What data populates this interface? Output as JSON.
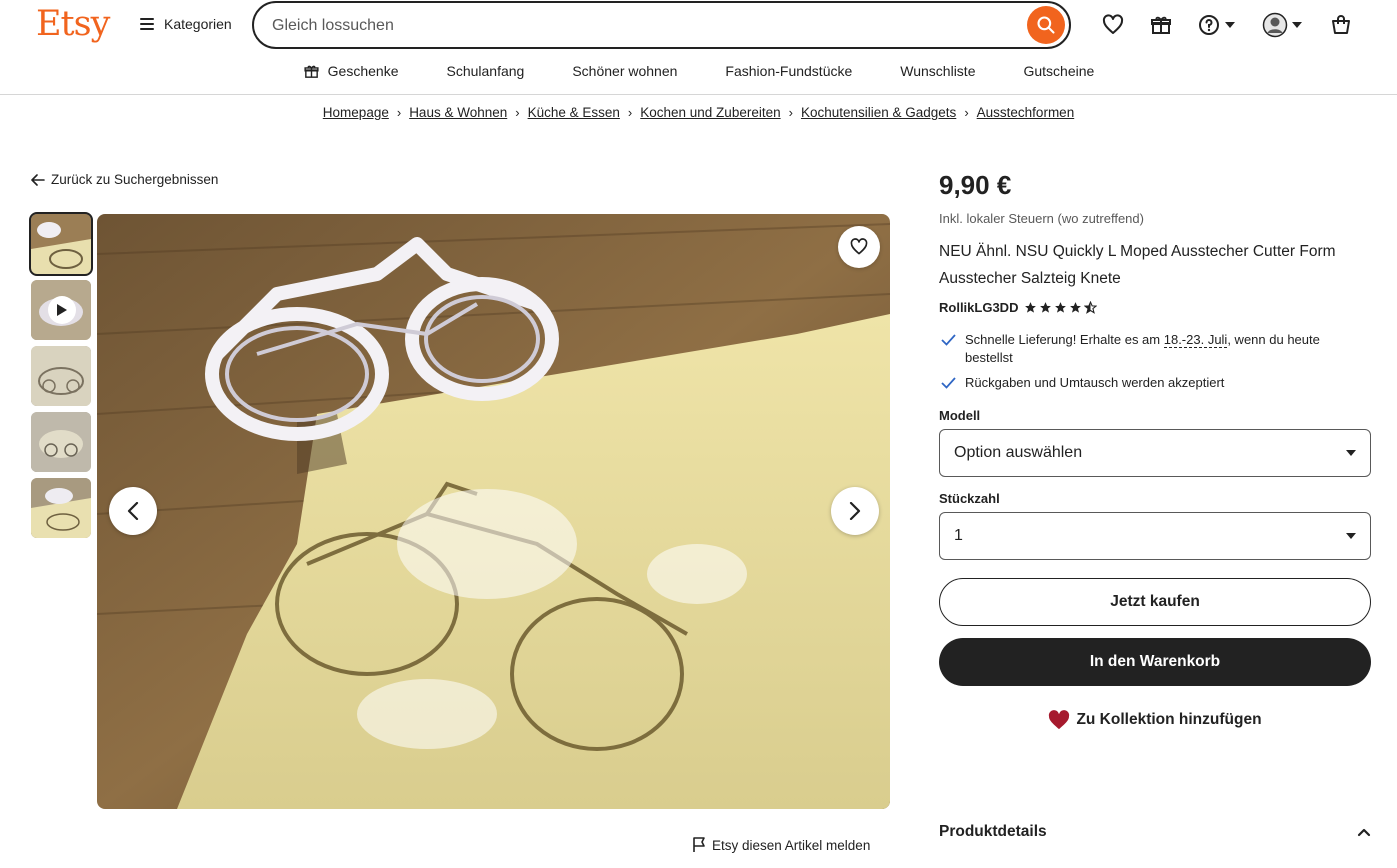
{
  "header": {
    "logo": "Etsy",
    "categories_label": "Kategorien",
    "search_placeholder": "Gleich lossuchen",
    "icons": [
      "heart-icon",
      "gift-icon",
      "help-icon",
      "account-icon",
      "cart-icon"
    ]
  },
  "subnav": [
    {
      "label": "Geschenke",
      "icon": "gift-icon"
    },
    {
      "label": "Schulanfang"
    },
    {
      "label": "Schöner wohnen"
    },
    {
      "label": "Fashion-Fundstücke"
    },
    {
      "label": "Wunschliste"
    },
    {
      "label": "Gutscheine"
    }
  ],
  "breadcrumb": [
    "Homepage",
    "Haus & Wohnen",
    "Küche & Essen",
    "Kochen und Zubereiten",
    "Kochutensilien & Gadgets",
    "Ausstechformen"
  ],
  "back_label": "Zurück zu Suchergebnissen",
  "report_label": "Etsy diesen Artikel melden",
  "product": {
    "price": "9,90 €",
    "tax_note": "Inkl. lokaler Steuern (wo zutreffend)",
    "title": "NEU Ähnl. NSU Quickly L Moped Ausstecher Cutter Form Ausstecher Salzteig Knete",
    "shop": "RollikLG3DD",
    "rating": 4.5,
    "feature1_prefix": "Schnelle Lieferung! Erhalte es am ",
    "feature1_date": "18.-23. Juli",
    "feature1_suffix": ", wenn du heute bestellst",
    "feature2": "Rückgaben und Umtausch werden akzeptiert",
    "model_label": "Modell",
    "model_value": "Option auswählen",
    "qty_label": "Stückzahl",
    "qty_value": "1",
    "buy_now": "Jetzt kaufen",
    "add_to_cart": "In den Warenkorb",
    "add_collection": "Zu Kollektion hinzufügen",
    "details_label": "Produktdetails"
  },
  "colors": {
    "brand": "#f1641e",
    "dark": "#222222",
    "heart": "#a61a2e"
  }
}
